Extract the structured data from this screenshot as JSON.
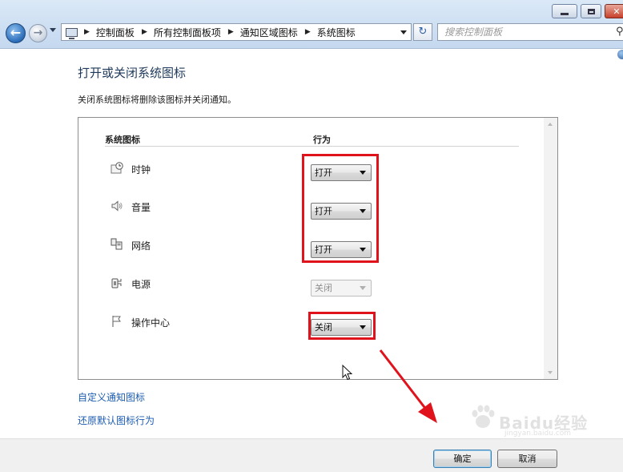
{
  "window": {
    "minimize_icon": "minimize-icon",
    "maximize_icon": "maximize-icon",
    "close_icon": "close-icon"
  },
  "nav": {
    "back_glyph": "←",
    "forward_glyph": "→"
  },
  "address": {
    "breadcrumbs": [
      "控制面板",
      "所有控制面板项",
      "通知区域图标",
      "系统图标"
    ],
    "separator": "▶"
  },
  "search": {
    "placeholder": "搜索控制面板",
    "glyph": "⚲"
  },
  "refresh_glyph": "↻",
  "page": {
    "title": "打开或关闭系统图标",
    "description": "关闭系统图标将删除该图标并关闭通知。"
  },
  "table": {
    "headers": {
      "icon": "系统图标",
      "behavior": "行为"
    },
    "rows": [
      {
        "label": "时钟",
        "icon": "clock-icon",
        "value": "打开",
        "disabled": false,
        "highlighted": true
      },
      {
        "label": "音量",
        "icon": "speaker-icon",
        "value": "打开",
        "disabled": false,
        "highlighted": true
      },
      {
        "label": "网络",
        "icon": "network-icon",
        "value": "打开",
        "disabled": false,
        "highlighted": true
      },
      {
        "label": "电源",
        "icon": "power-icon",
        "value": "关闭",
        "disabled": true,
        "highlighted": false
      },
      {
        "label": "操作中心",
        "icon": "flag-icon",
        "value": "关闭",
        "disabled": false,
        "highlighted": true
      }
    ]
  },
  "links": {
    "customize": "自定义通知图标",
    "restore": "还原默认图标行为"
  },
  "footer": {
    "ok": "确定",
    "cancel": "取消"
  },
  "annotation": {
    "color": "#e0131c"
  },
  "watermark": {
    "text": "Baidu经验",
    "sub": "jingyan.baidu.com"
  }
}
